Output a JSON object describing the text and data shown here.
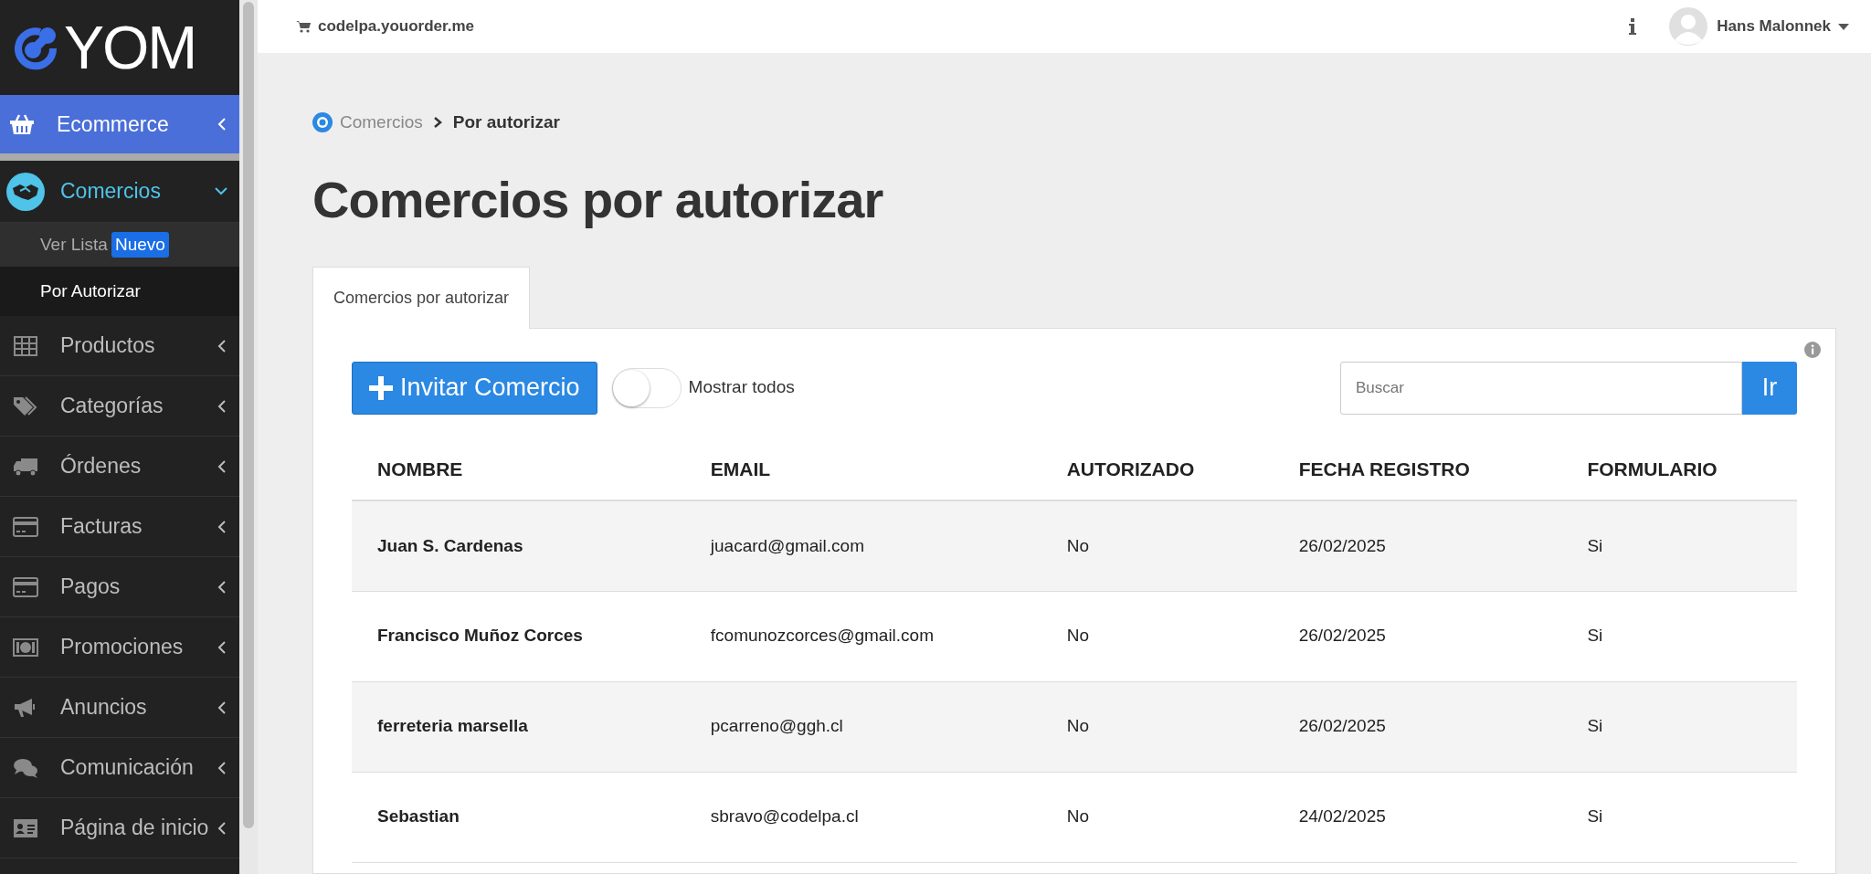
{
  "header": {
    "site": "codelpa.youorder.me",
    "user": "Hans Malonnek"
  },
  "sidebar": {
    "logo": "YOM",
    "items": [
      {
        "kind": "section",
        "label": "Ecommerce",
        "expanded": false
      },
      {
        "kind": "menu",
        "label": "Comercios",
        "expanded": true,
        "selected": true,
        "children": [
          {
            "label": "Ver Lista",
            "badge": "Nuevo",
            "selected": false
          },
          {
            "label": "Por Autorizar",
            "selected": true
          }
        ]
      },
      {
        "kind": "menu",
        "label": "Productos",
        "expanded": false,
        "selected": false
      },
      {
        "kind": "menu",
        "label": "Categorías",
        "expanded": false,
        "selected": false
      },
      {
        "kind": "menu",
        "label": "Órdenes",
        "expanded": false,
        "selected": false
      },
      {
        "kind": "menu",
        "label": "Facturas",
        "expanded": false,
        "selected": false
      },
      {
        "kind": "menu",
        "label": "Pagos",
        "expanded": false,
        "selected": false
      },
      {
        "kind": "menu",
        "label": "Promociones",
        "expanded": false,
        "selected": false
      },
      {
        "kind": "menu",
        "label": "Anuncios",
        "expanded": false,
        "selected": false
      },
      {
        "kind": "menu",
        "label": "Comunicación",
        "expanded": false,
        "selected": false
      },
      {
        "kind": "menu",
        "label": "Página de inicio",
        "expanded": false,
        "selected": false
      }
    ]
  },
  "breadcrumb": [
    "Comercios",
    "Por autorizar"
  ],
  "title": "Comercios por autorizar",
  "tabs": [
    {
      "label": "Comercios por autorizar",
      "selected": true
    }
  ],
  "toolbar": {
    "invite_button": "Invitar Comercio",
    "toggle": {
      "label": "Mostrar todos",
      "on": false
    },
    "search": {
      "placeholder": "Buscar"
    },
    "search_button": "Ir"
  },
  "table": {
    "columns": [
      "NOMBRE",
      "EMAIL",
      "AUTORIZADO",
      "FECHA REGISTRO",
      "FORMULARIO"
    ],
    "rows": [
      [
        "Juan S. Cardenas",
        "juacard@gmail.com",
        "No",
        "26/02/2025",
        "Si"
      ],
      [
        "Francisco Muñoz Corces",
        "fcomunozcorces@gmail.com",
        "No",
        "26/02/2025",
        "Si"
      ],
      [
        "ferreteria marsella",
        "pcarreno@ggh.cl",
        "No",
        "26/02/2025",
        "Si"
      ],
      [
        "Sebastian",
        "sbravo@codelpa.cl",
        "No",
        "24/02/2025",
        "Si"
      ]
    ]
  }
}
